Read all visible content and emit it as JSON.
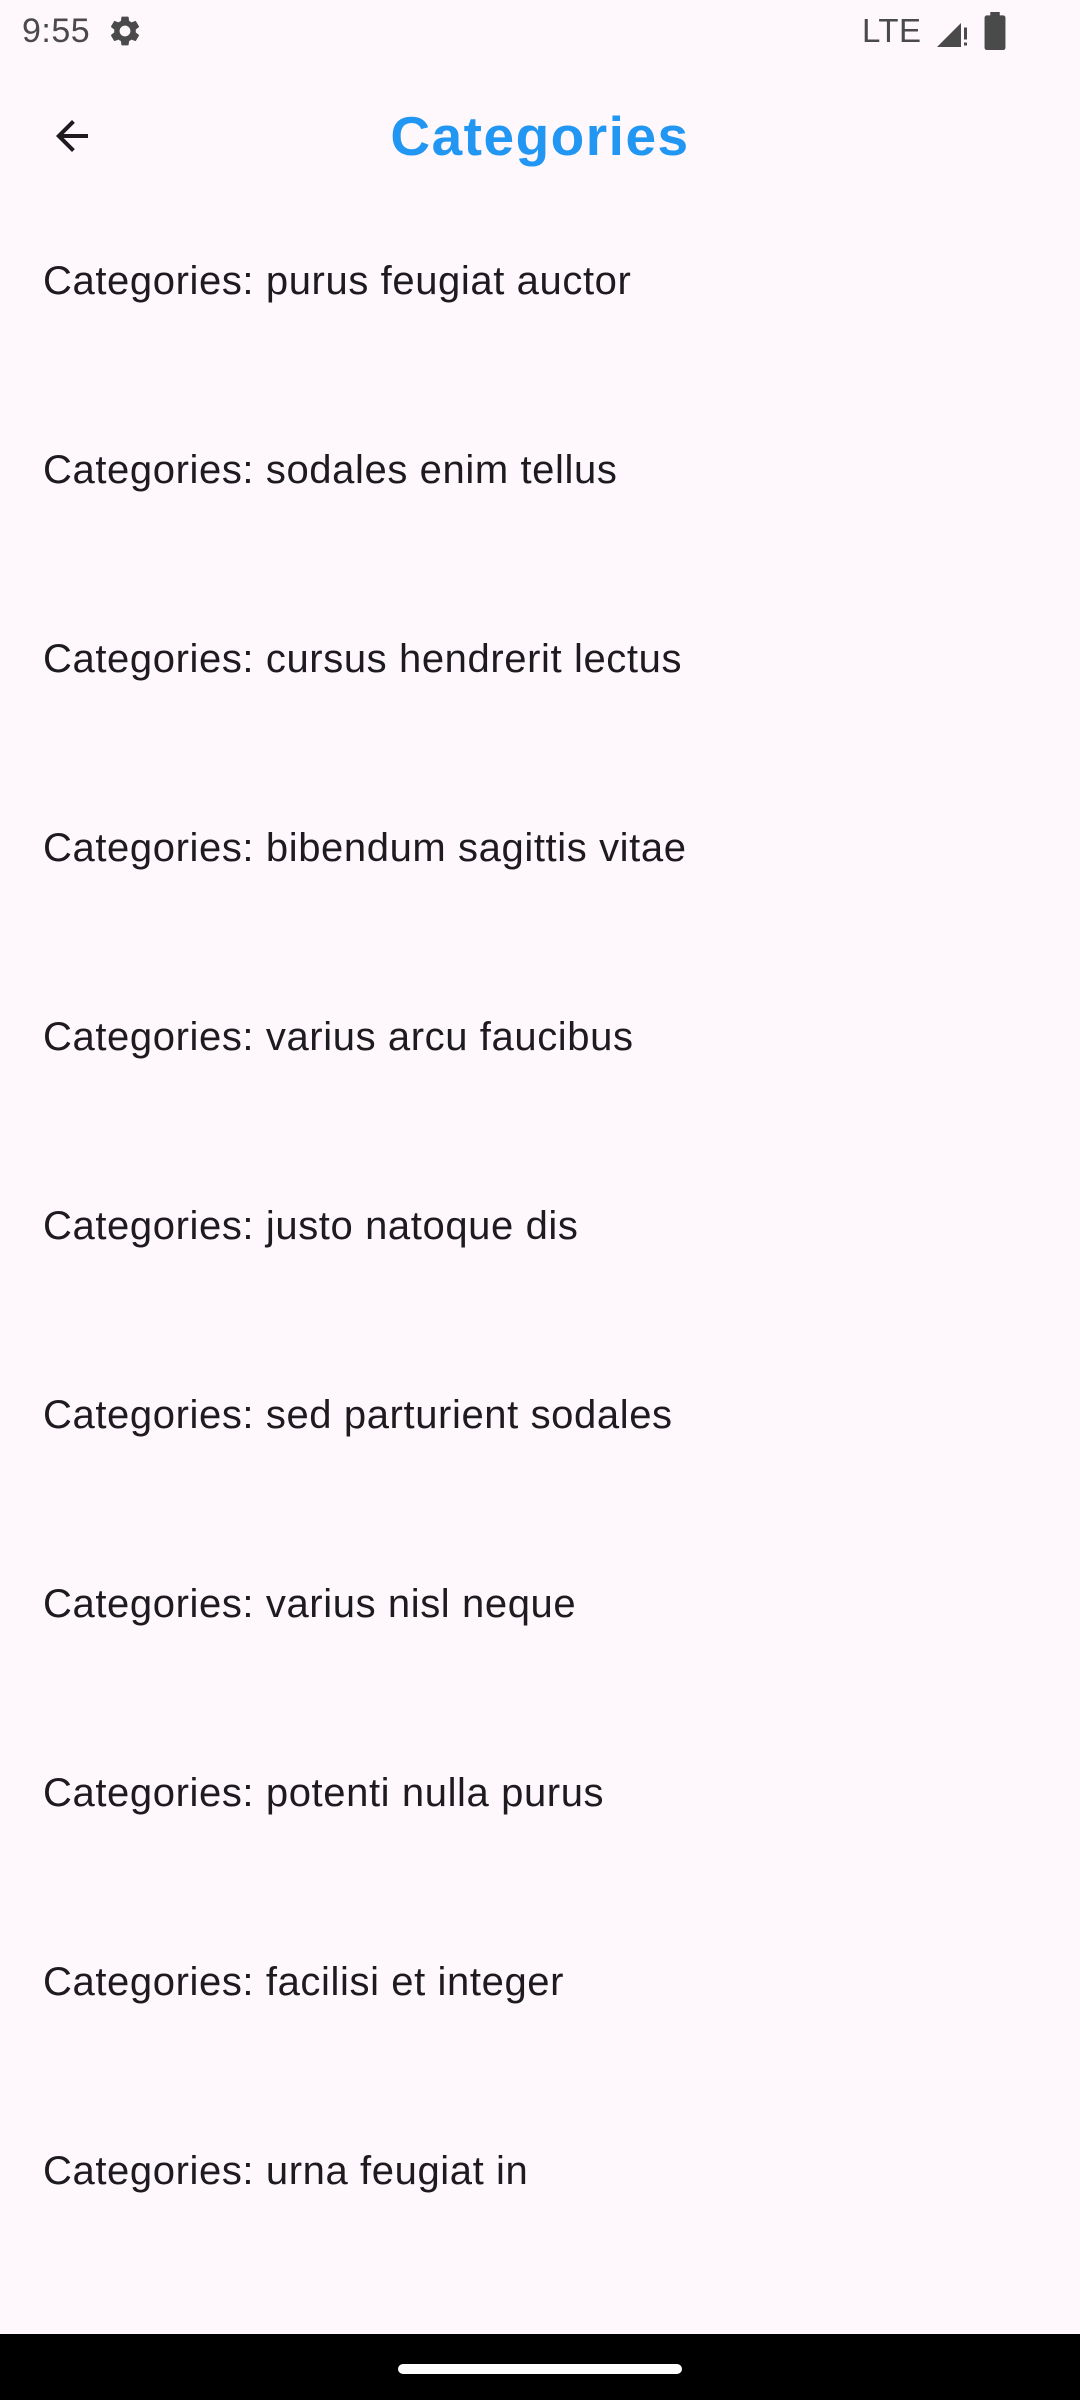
{
  "status_bar": {
    "time": "9:55",
    "network": "LTE",
    "icons": [
      "gear-icon",
      "signal-icon",
      "battery-icon"
    ]
  },
  "app_bar": {
    "title": "Categories",
    "back_icon": "arrow-back-icon",
    "title_color": "#2196f3"
  },
  "list": {
    "items": [
      {
        "label": "Categories: purus feugiat auctor"
      },
      {
        "label": "Categories: sodales enim tellus"
      },
      {
        "label": "Categories: cursus hendrerit lectus"
      },
      {
        "label": "Categories: bibendum sagittis vitae"
      },
      {
        "label": "Categories: varius arcu faucibus"
      },
      {
        "label": "Categories: justo natoque dis"
      },
      {
        "label": "Categories: sed parturient sodales"
      },
      {
        "label": "Categories: varius nisl neque"
      },
      {
        "label": "Categories: potenti nulla purus"
      },
      {
        "label": "Categories: facilisi et integer"
      },
      {
        "label": "Categories: urna feugiat in"
      }
    ]
  },
  "colors": {
    "background": "#fef7fc",
    "text": "#1d1b20",
    "accent": "#2196f3"
  }
}
